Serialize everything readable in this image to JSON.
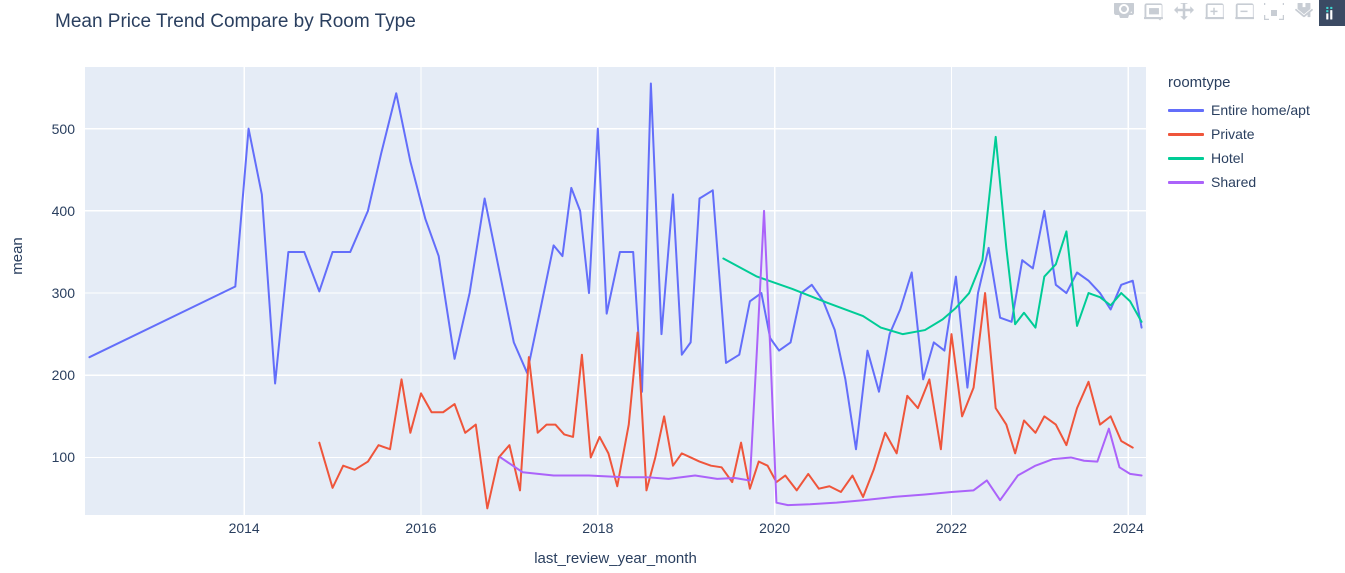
{
  "chart_data": {
    "type": "line",
    "title": "Mean Price Trend Compare by Room Type",
    "xlabel": "last_review_year_month",
    "ylabel": "mean",
    "legend_title": "roomtype",
    "legend_position": "right",
    "grid": true,
    "xlim": [
      2012.2,
      2024.2
    ],
    "ylim": [
      30,
      575
    ],
    "xticks": [
      "2014",
      "2016",
      "2018",
      "2020",
      "2022",
      "2024"
    ],
    "xtick_values": [
      2014,
      2016,
      2018,
      2020,
      2022,
      2024
    ],
    "yticks": [
      "100",
      "200",
      "300",
      "400",
      "500"
    ],
    "ytick_values": [
      100,
      200,
      300,
      400,
      500
    ],
    "plot_bgcolor": "#E5ECF6",
    "paper_bgcolor": "#FFFFFF",
    "gridcolor": "#FFFFFF",
    "series": [
      {
        "name": "Entire home/apt",
        "color": "#636EFA",
        "x": [
          2012.25,
          2013.9,
          2014.05,
          2014.2,
          2014.35,
          2014.5,
          2014.68,
          2014.85,
          2015.0,
          2015.2,
          2015.4,
          2015.55,
          2015.72,
          2015.88,
          2016.05,
          2016.2,
          2016.38,
          2016.55,
          2016.72,
          2016.88,
          2017.05,
          2017.2,
          2017.35,
          2017.5,
          2017.6,
          2017.7,
          2017.8,
          2017.9,
          2018.0,
          2018.1,
          2018.25,
          2018.4,
          2018.5,
          2018.6,
          2018.72,
          2018.85,
          2018.95,
          2019.05,
          2019.15,
          2019.3,
          2019.45,
          2019.6,
          2019.72,
          2019.85,
          2019.95,
          2020.05,
          2020.18,
          2020.3,
          2020.42,
          2020.55,
          2020.68,
          2020.8,
          2020.92,
          2021.05,
          2021.18,
          2021.3,
          2021.42,
          2021.55,
          2021.68,
          2021.8,
          2021.92,
          2022.05,
          2022.18,
          2022.3,
          2022.42,
          2022.55,
          2022.68,
          2022.8,
          2022.92,
          2023.05,
          2023.18,
          2023.3,
          2023.42,
          2023.55,
          2023.68,
          2023.8,
          2023.92,
          2024.05,
          2024.15
        ],
        "y": [
          222,
          308,
          500,
          420,
          190,
          350,
          350,
          302,
          350,
          350,
          400,
          470,
          543,
          460,
          390,
          345,
          220,
          300,
          415,
          330,
          240,
          203,
          280,
          358,
          345,
          428,
          400,
          300,
          500,
          275,
          350,
          350,
          180,
          555,
          250,
          420,
          225,
          240,
          415,
          425,
          215,
          225,
          290,
          300,
          245,
          230,
          240,
          300,
          310,
          290,
          255,
          195,
          110,
          230,
          180,
          250,
          280,
          325,
          195,
          240,
          230,
          320,
          185,
          300,
          355,
          270,
          265,
          340,
          330,
          400,
          310,
          300,
          325,
          315,
          300,
          280,
          310,
          315,
          258
        ]
      },
      {
        "name": "Private",
        "color": "#EF553B",
        "x": [
          2014.85,
          2015.0,
          2015.12,
          2015.25,
          2015.4,
          2015.52,
          2015.65,
          2015.78,
          2015.88,
          2016.0,
          2016.12,
          2016.25,
          2016.38,
          2016.5,
          2016.62,
          2016.75,
          2016.88,
          2017.0,
          2017.12,
          2017.22,
          2017.32,
          2017.42,
          2017.52,
          2017.62,
          2017.72,
          2017.82,
          2017.92,
          2018.02,
          2018.12,
          2018.22,
          2018.35,
          2018.45,
          2018.55,
          2018.65,
          2018.75,
          2018.85,
          2018.95,
          2019.05,
          2019.15,
          2019.28,
          2019.4,
          2019.52,
          2019.62,
          2019.72,
          2019.82,
          2019.92,
          2020.02,
          2020.12,
          2020.25,
          2020.38,
          2020.5,
          2020.62,
          2020.75,
          2020.88,
          2021.0,
          2021.12,
          2021.25,
          2021.38,
          2021.5,
          2021.62,
          2021.75,
          2021.88,
          2022.0,
          2022.12,
          2022.25,
          2022.38,
          2022.5,
          2022.62,
          2022.72,
          2022.82,
          2022.95,
          2023.05,
          2023.18,
          2023.3,
          2023.42,
          2023.55,
          2023.68,
          2023.8,
          2023.92,
          2024.05,
          2024.15
        ],
        "y": [
          118,
          63,
          90,
          85,
          95,
          115,
          110,
          195,
          130,
          178,
          155,
          155,
          165,
          130,
          140,
          38,
          100,
          115,
          60,
          222,
          130,
          140,
          140,
          128,
          125,
          225,
          100,
          125,
          105,
          65,
          140,
          252,
          60,
          100,
          150,
          90,
          105,
          100,
          95,
          90,
          88,
          70,
          118,
          62,
          95,
          90,
          70,
          78,
          60,
          80,
          62,
          65,
          58,
          78,
          52,
          85,
          130,
          105,
          175,
          160,
          195,
          110,
          250,
          150,
          185,
          300,
          160,
          140,
          105,
          145,
          130,
          150,
          140,
          115,
          160,
          192,
          140,
          150,
          120,
          112
        ]
      },
      {
        "name": "Hotel",
        "color": "#00CC96",
        "x": [
          2019.42,
          2019.8,
          2020.2,
          2020.6,
          2021.0,
          2021.2,
          2021.45,
          2021.7,
          2021.9,
          2022.05,
          2022.2,
          2022.35,
          2022.5,
          2022.62,
          2022.72,
          2022.82,
          2022.95,
          2023.05,
          2023.18,
          2023.3,
          2023.42,
          2023.55,
          2023.68,
          2023.8,
          2023.92,
          2024.02,
          2024.15
        ],
        "y": [
          342,
          320,
          305,
          288,
          272,
          258,
          250,
          255,
          268,
          282,
          300,
          340,
          490,
          355,
          262,
          276,
          258,
          320,
          335,
          375,
          260,
          300,
          295,
          285,
          300,
          290,
          265
        ]
      },
      {
        "name": "Shared",
        "color": "#AB63FA",
        "x": [
          2016.9,
          2017.15,
          2017.5,
          2017.9,
          2018.3,
          2018.55,
          2018.8,
          2019.1,
          2019.35,
          2019.55,
          2019.72,
          2019.8,
          2019.88,
          2019.95,
          2020.02,
          2020.15,
          2020.4,
          2020.7,
          2021.0,
          2021.35,
          2021.7,
          2022.0,
          2022.25,
          2022.4,
          2022.55,
          2022.75,
          2022.95,
          2023.15,
          2023.35,
          2023.5,
          2023.65,
          2023.78,
          2023.9,
          2024.02,
          2024.15
        ],
        "y": [
          100,
          82,
          78,
          78,
          76,
          76,
          74,
          78,
          74,
          75,
          72,
          232,
          400,
          232,
          45,
          42,
          43,
          45,
          48,
          52,
          55,
          58,
          60,
          72,
          48,
          78,
          90,
          98,
          100,
          96,
          95,
          135,
          88,
          80,
          78
        ]
      }
    ]
  },
  "modebar": {
    "buttons": [
      {
        "name": "download-plot-icon",
        "label": "Download plot as a png"
      },
      {
        "name": "zoom-icon",
        "label": "Zoom"
      },
      {
        "name": "pan-icon",
        "label": "Pan"
      },
      {
        "name": "zoom-in-icon",
        "label": "Zoom in"
      },
      {
        "name": "zoom-out-icon",
        "label": "Zoom out"
      },
      {
        "name": "autoscale-icon",
        "label": "Autoscale"
      },
      {
        "name": "reset-axes-icon",
        "label": "Reset axes"
      },
      {
        "name": "plotly-logo-icon",
        "label": "Produced with Plotly"
      }
    ]
  }
}
